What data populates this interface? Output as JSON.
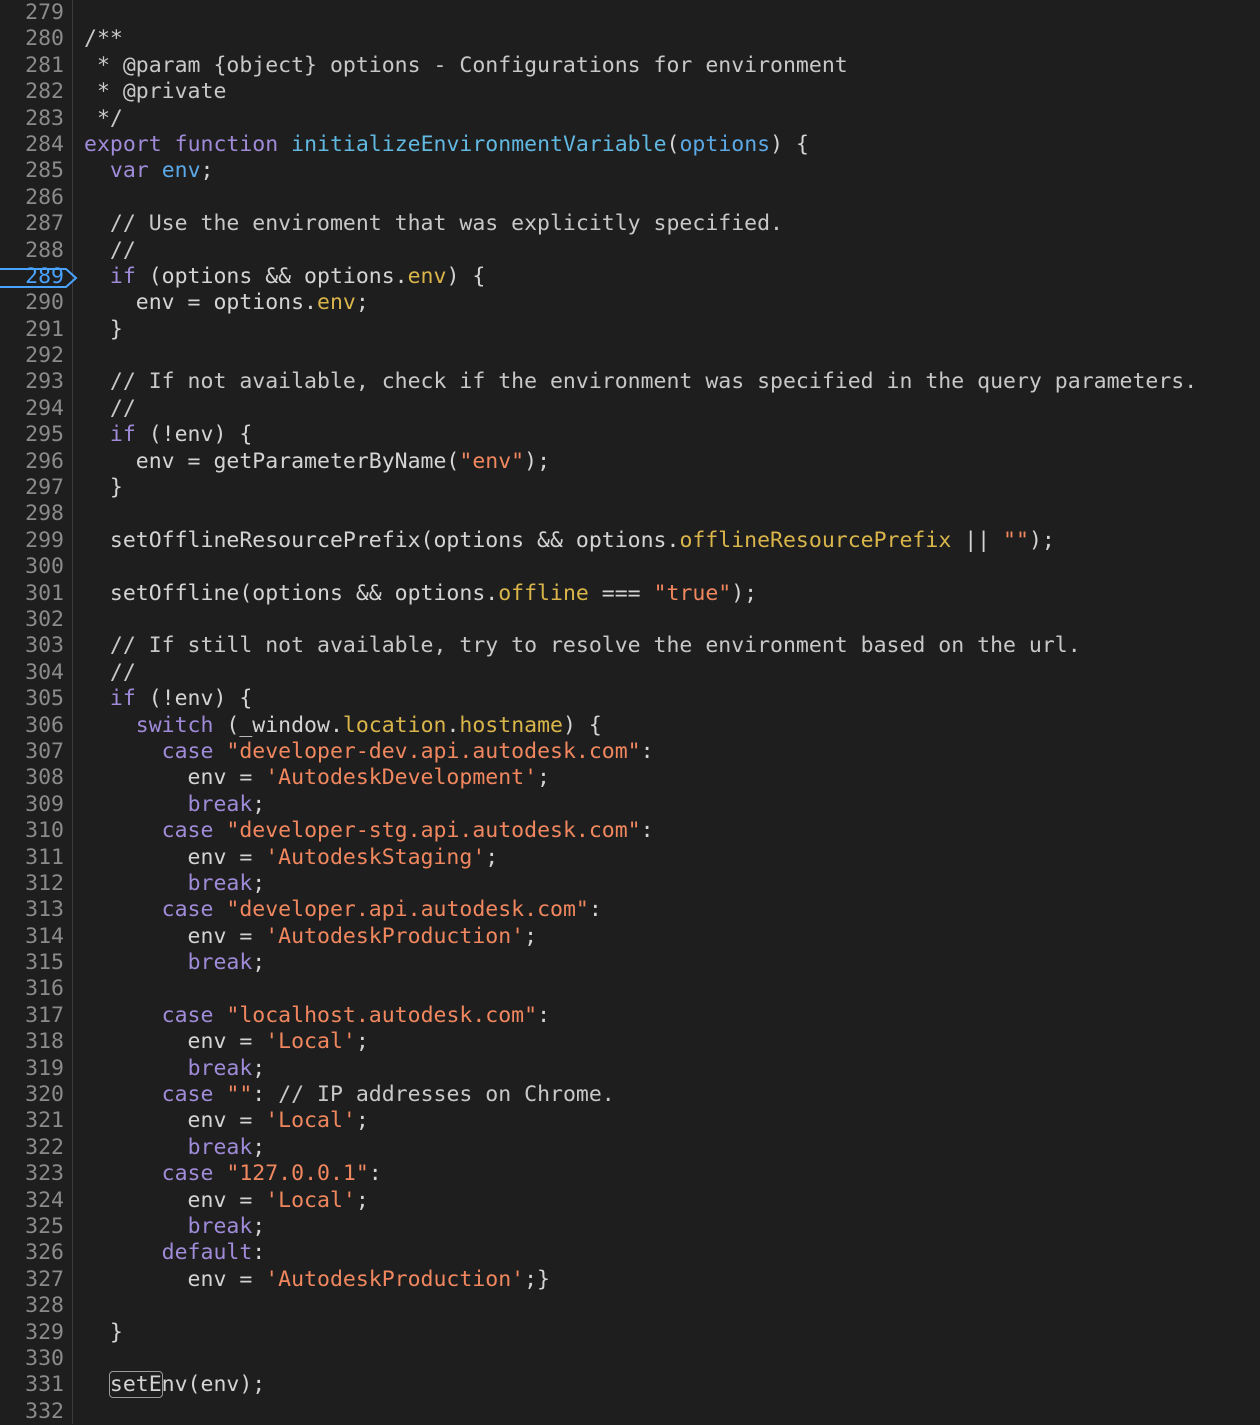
{
  "editor": {
    "active_line": 289,
    "lines": [
      {
        "no": "279",
        "tokens": []
      },
      {
        "no": "280",
        "tokens": [
          {
            "t": "/**",
            "c": "comment"
          }
        ]
      },
      {
        "no": "281",
        "tokens": [
          {
            "t": " * @param {object} options - Configurations for environment",
            "c": "comment"
          }
        ]
      },
      {
        "no": "282",
        "tokens": [
          {
            "t": " * @private",
            "c": "comment"
          }
        ]
      },
      {
        "no": "283",
        "tokens": [
          {
            "t": " */",
            "c": "comment"
          }
        ]
      },
      {
        "no": "284",
        "tokens": [
          {
            "t": "export",
            "c": "keyword"
          },
          {
            "t": " "
          },
          {
            "t": "function",
            "c": "keyword"
          },
          {
            "t": " "
          },
          {
            "t": "initializeEnvironmentVariable",
            "c": "func"
          },
          {
            "t": "("
          },
          {
            "t": "options",
            "c": "param"
          },
          {
            "t": ") {"
          }
        ]
      },
      {
        "no": "285",
        "tokens": [
          {
            "t": "  "
          },
          {
            "t": "var",
            "c": "keyword"
          },
          {
            "t": " "
          },
          {
            "t": "env",
            "c": "param"
          },
          {
            "t": ";"
          }
        ]
      },
      {
        "no": "286",
        "tokens": []
      },
      {
        "no": "287",
        "tokens": [
          {
            "t": "  // Use the enviroment that was explicitly specified.",
            "c": "comment"
          }
        ]
      },
      {
        "no": "288",
        "tokens": [
          {
            "t": "  //",
            "c": "comment"
          }
        ]
      },
      {
        "no": "289",
        "tokens": [
          {
            "t": "  "
          },
          {
            "t": "if",
            "c": "keyword"
          },
          {
            "t": " (options && options."
          },
          {
            "t": "env",
            "c": "prop"
          },
          {
            "t": ") {"
          }
        ]
      },
      {
        "no": "290",
        "tokens": [
          {
            "t": "    env = options."
          },
          {
            "t": "env",
            "c": "prop"
          },
          {
            "t": ";"
          }
        ]
      },
      {
        "no": "291",
        "tokens": [
          {
            "t": "  }"
          }
        ]
      },
      {
        "no": "292",
        "tokens": []
      },
      {
        "no": "293",
        "tokens": [
          {
            "t": "  // If not available, check if the environment was specified in the query parameters.",
            "c": "comment"
          }
        ]
      },
      {
        "no": "294",
        "tokens": [
          {
            "t": "  //",
            "c": "comment"
          }
        ]
      },
      {
        "no": "295",
        "tokens": [
          {
            "t": "  "
          },
          {
            "t": "if",
            "c": "keyword"
          },
          {
            "t": " (!env) {"
          }
        ]
      },
      {
        "no": "296",
        "tokens": [
          {
            "t": "    env = getParameterByName("
          },
          {
            "t": "\"env\"",
            "c": "str"
          },
          {
            "t": ");"
          }
        ]
      },
      {
        "no": "297",
        "tokens": [
          {
            "t": "  }"
          }
        ]
      },
      {
        "no": "298",
        "tokens": []
      },
      {
        "no": "299",
        "tokens": [
          {
            "t": "  setOfflineResourcePrefix(options && options."
          },
          {
            "t": "offlineResourcePrefix",
            "c": "prop"
          },
          {
            "t": " || "
          },
          {
            "t": "\"\"",
            "c": "str"
          },
          {
            "t": ");"
          }
        ]
      },
      {
        "no": "300",
        "tokens": []
      },
      {
        "no": "301",
        "tokens": [
          {
            "t": "  setOffline(options && options."
          },
          {
            "t": "offline",
            "c": "prop"
          },
          {
            "t": " === "
          },
          {
            "t": "\"true\"",
            "c": "str"
          },
          {
            "t": ");"
          }
        ]
      },
      {
        "no": "302",
        "tokens": []
      },
      {
        "no": "303",
        "tokens": [
          {
            "t": "  // If still not available, try to resolve the environment based on the url.",
            "c": "comment"
          }
        ]
      },
      {
        "no": "304",
        "tokens": [
          {
            "t": "  //",
            "c": "comment"
          }
        ]
      },
      {
        "no": "305",
        "tokens": [
          {
            "t": "  "
          },
          {
            "t": "if",
            "c": "keyword"
          },
          {
            "t": " (!env) {"
          }
        ]
      },
      {
        "no": "306",
        "tokens": [
          {
            "t": "    "
          },
          {
            "t": "switch",
            "c": "keyword"
          },
          {
            "t": " (_window."
          },
          {
            "t": "location",
            "c": "prop"
          },
          {
            "t": "."
          },
          {
            "t": "hostname",
            "c": "prop"
          },
          {
            "t": ") {"
          }
        ]
      },
      {
        "no": "307",
        "tokens": [
          {
            "t": "      "
          },
          {
            "t": "case",
            "c": "keyword"
          },
          {
            "t": " "
          },
          {
            "t": "\"developer-dev.api.autodesk.com\"",
            "c": "str"
          },
          {
            "t": ":"
          }
        ]
      },
      {
        "no": "308",
        "tokens": [
          {
            "t": "        env = "
          },
          {
            "t": "'AutodeskDevelopment'",
            "c": "str"
          },
          {
            "t": ";"
          }
        ]
      },
      {
        "no": "309",
        "tokens": [
          {
            "t": "        "
          },
          {
            "t": "break",
            "c": "keyword"
          },
          {
            "t": ";"
          }
        ]
      },
      {
        "no": "310",
        "tokens": [
          {
            "t": "      "
          },
          {
            "t": "case",
            "c": "keyword"
          },
          {
            "t": " "
          },
          {
            "t": "\"developer-stg.api.autodesk.com\"",
            "c": "str"
          },
          {
            "t": ":"
          }
        ]
      },
      {
        "no": "311",
        "tokens": [
          {
            "t": "        env = "
          },
          {
            "t": "'AutodeskStaging'",
            "c": "str"
          },
          {
            "t": ";"
          }
        ]
      },
      {
        "no": "312",
        "tokens": [
          {
            "t": "        "
          },
          {
            "t": "break",
            "c": "keyword"
          },
          {
            "t": ";"
          }
        ]
      },
      {
        "no": "313",
        "tokens": [
          {
            "t": "      "
          },
          {
            "t": "case",
            "c": "keyword"
          },
          {
            "t": " "
          },
          {
            "t": "\"developer.api.autodesk.com\"",
            "c": "str"
          },
          {
            "t": ":"
          }
        ]
      },
      {
        "no": "314",
        "tokens": [
          {
            "t": "        env = "
          },
          {
            "t": "'AutodeskProduction'",
            "c": "str"
          },
          {
            "t": ";"
          }
        ]
      },
      {
        "no": "315",
        "tokens": [
          {
            "t": "        "
          },
          {
            "t": "break",
            "c": "keyword"
          },
          {
            "t": ";"
          }
        ]
      },
      {
        "no": "316",
        "tokens": []
      },
      {
        "no": "317",
        "tokens": [
          {
            "t": "      "
          },
          {
            "t": "case",
            "c": "keyword"
          },
          {
            "t": " "
          },
          {
            "t": "\"localhost.autodesk.com\"",
            "c": "str"
          },
          {
            "t": ":"
          }
        ]
      },
      {
        "no": "318",
        "tokens": [
          {
            "t": "        env = "
          },
          {
            "t": "'Local'",
            "c": "str"
          },
          {
            "t": ";"
          }
        ]
      },
      {
        "no": "319",
        "tokens": [
          {
            "t": "        "
          },
          {
            "t": "break",
            "c": "keyword"
          },
          {
            "t": ";"
          }
        ]
      },
      {
        "no": "320",
        "tokens": [
          {
            "t": "      "
          },
          {
            "t": "case",
            "c": "keyword"
          },
          {
            "t": " "
          },
          {
            "t": "\"\"",
            "c": "str"
          },
          {
            "t": ": "
          },
          {
            "t": "// IP addresses on Chrome.",
            "c": "comment"
          }
        ]
      },
      {
        "no": "321",
        "tokens": [
          {
            "t": "        env = "
          },
          {
            "t": "'Local'",
            "c": "str"
          },
          {
            "t": ";"
          }
        ]
      },
      {
        "no": "322",
        "tokens": [
          {
            "t": "        "
          },
          {
            "t": "break",
            "c": "keyword"
          },
          {
            "t": ";"
          }
        ]
      },
      {
        "no": "323",
        "tokens": [
          {
            "t": "      "
          },
          {
            "t": "case",
            "c": "keyword"
          },
          {
            "t": " "
          },
          {
            "t": "\"127.0.0.1\"",
            "c": "str"
          },
          {
            "t": ":"
          }
        ]
      },
      {
        "no": "324",
        "tokens": [
          {
            "t": "        env = "
          },
          {
            "t": "'Local'",
            "c": "str"
          },
          {
            "t": ";"
          }
        ]
      },
      {
        "no": "325",
        "tokens": [
          {
            "t": "        "
          },
          {
            "t": "break",
            "c": "keyword"
          },
          {
            "t": ";"
          }
        ]
      },
      {
        "no": "326",
        "tokens": [
          {
            "t": "      "
          },
          {
            "t": "default",
            "c": "keyword"
          },
          {
            "t": ":"
          }
        ]
      },
      {
        "no": "327",
        "tokens": [
          {
            "t": "        env = "
          },
          {
            "t": "'AutodeskProduction'",
            "c": "str"
          },
          {
            "t": ";}"
          }
        ]
      },
      {
        "no": "328",
        "tokens": []
      },
      {
        "no": "329",
        "tokens": [
          {
            "t": "  }"
          }
        ]
      },
      {
        "no": "330",
        "tokens": []
      },
      {
        "no": "331",
        "tokens": [
          {
            "t": "  "
          },
          {
            "t": "setE",
            "c": "hl"
          },
          {
            "t": "nv(env);"
          }
        ]
      },
      {
        "no": "332",
        "tokens": []
      }
    ]
  },
  "colors": {
    "background": "#1e1e1f",
    "line_number": "#8b8b8b",
    "active_line_number": "#4aa3ff",
    "keyword": "#a08bd8",
    "function": "#61b8e0",
    "param": "#5ba8e6",
    "property": "#d9b54a",
    "string": "#f0875e",
    "comment": "#c8c8c8"
  },
  "icons": {
    "breakpoint": "breakpoint-marker-icon"
  }
}
